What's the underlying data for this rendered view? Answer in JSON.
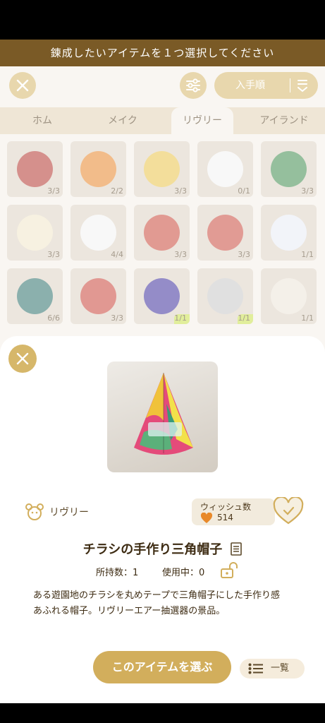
{
  "header": {
    "title": "錬成したいアイテムを１つ選択してください"
  },
  "toolbar": {
    "sort_label": "入手順"
  },
  "tabs": [
    {
      "label": "ホム"
    },
    {
      "label": "メイク"
    },
    {
      "label": "リヴリー"
    },
    {
      "label": "アイランド"
    }
  ],
  "grid": {
    "items": [
      {
        "count": "3/3",
        "color": "#b3352f"
      },
      {
        "count": "2/2",
        "color": "#e8862a"
      },
      {
        "count": "3/3",
        "color": "#e9c44a"
      },
      {
        "count": "0/1",
        "color": "#f2f2f2"
      },
      {
        "count": "3/3",
        "color": "#3f8a4e"
      },
      {
        "count": "3/3",
        "color": "#f0e6c8"
      },
      {
        "count": "4/4",
        "color": "#f2f2f2"
      },
      {
        "count": "3/3",
        "color": "#c9473a"
      },
      {
        "count": "3/3",
        "color": "#c94a3d"
      },
      {
        "count": "1/1",
        "color": "#e8ebf4"
      },
      {
        "count": "6/6",
        "color": "#2d6f6b"
      },
      {
        "count": "3/3",
        "color": "#c8443a"
      },
      {
        "count": "1/1",
        "color": "#3c2f9c"
      },
      {
        "count": "1/1",
        "color": "#c7c7c7"
      },
      {
        "count": "1/1",
        "color": "#ece4d8"
      }
    ]
  },
  "detail": {
    "category": "リヴリー",
    "wish_label": "ウィッシュ数",
    "wish_count": "514",
    "name": "チラシの手作り三角帽子",
    "owned": "所持数：1",
    "in_use": "使用中：0",
    "description": "ある遊園地のチラシを丸めテープで三角帽子にした手作り感あふれる帽子。リヴリーエアー抽選器の景品。",
    "select_button": "このアイテムを選ぶ",
    "list_button": "一覧"
  },
  "colors": {
    "accent": "#d6b76a",
    "header": "#7a5a26"
  }
}
